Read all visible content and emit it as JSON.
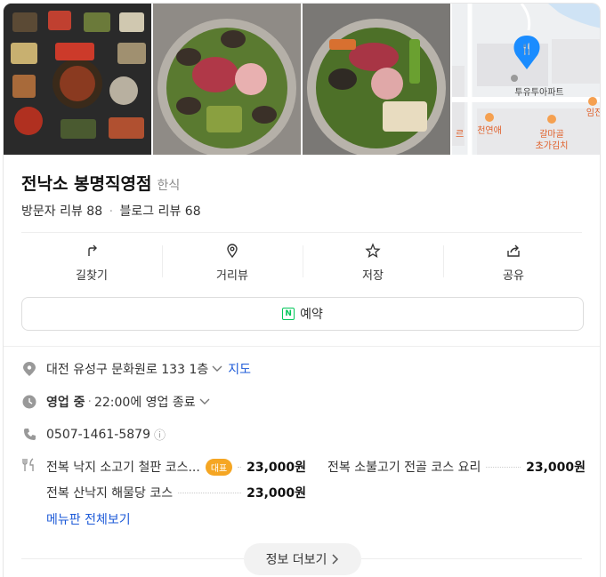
{
  "place": {
    "name": "전낙소 봉명직영점",
    "category": "한식",
    "visitor_reviews": "방문자 리뷰 88",
    "dot": "·",
    "blog_reviews": "블로그 리뷰 68"
  },
  "actions": [
    {
      "label": "길찾기",
      "icon": "directions-icon"
    },
    {
      "label": "거리뷰",
      "icon": "streetview-icon"
    },
    {
      "label": "저장",
      "icon": "star-icon"
    },
    {
      "label": "공유",
      "icon": "share-icon"
    }
  ],
  "reserve": {
    "badge": "N",
    "label": "예약"
  },
  "map": {
    "labels": [
      "투유투아파트",
      "천연애",
      "갈마골",
      "초가김치",
      "임진",
      "르"
    ]
  },
  "info": {
    "address": "대전 유성구 문화원로 133 1층",
    "map_link": "지도",
    "status": "영업 중",
    "hours_sep": "·",
    "hours": "22:00에 영업 종료",
    "phone": "0507-1461-5879",
    "info_icon": "ⓘ"
  },
  "menu": [
    {
      "name": "전복 낙지 소고기 철판 코스...",
      "badge": "대표",
      "price": "23,000원"
    },
    {
      "name": "전복 소불고기 전골 코스 요리",
      "price": "23,000원"
    },
    {
      "name": "전복 산낙지 해물당 코스",
      "price": "23,000원"
    }
  ],
  "menu_all": "메뉴판 전체보기",
  "more": "정보 더보기",
  "colors": {
    "accent": "#1e5bd8",
    "badge": "#f5a623",
    "naver": "#03c75a",
    "pin": "#1a8cff"
  }
}
